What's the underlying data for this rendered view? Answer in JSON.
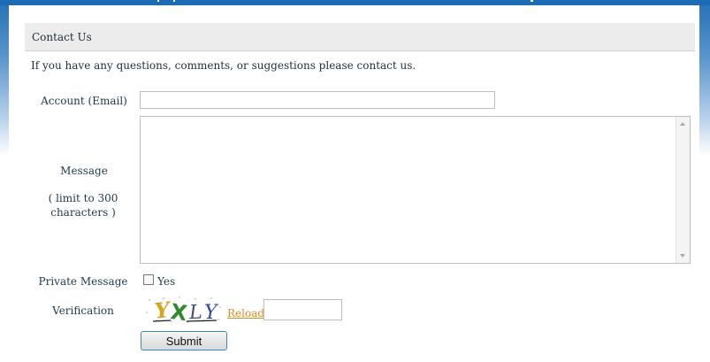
{
  "page": {
    "title": "Contact Us",
    "intro": "If you have any questions, comments, or suggestions please contact us."
  },
  "form": {
    "account": {
      "label": "Account (Email)",
      "value": ""
    },
    "message": {
      "label": "Message",
      "hint": "( limit to 300 characters )",
      "value": ""
    },
    "private_message": {
      "label": "Private Message",
      "option_label": "Yes",
      "checked": false
    },
    "verification": {
      "label": "Verification",
      "captcha_text": "YXLY",
      "reload_label": "Reload",
      "value": ""
    },
    "submit_label": "Submit"
  },
  "colors": {
    "top_bar": "#1b6cb5",
    "header_bg": "#ececec",
    "reload_link": "#e08a1e",
    "button_border": "#3b87c8"
  }
}
